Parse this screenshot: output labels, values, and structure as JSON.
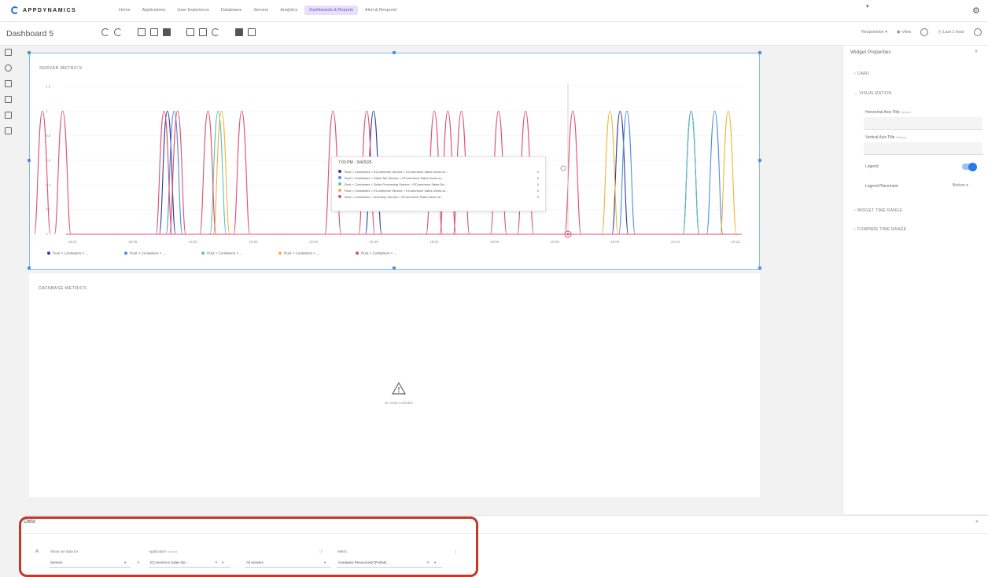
{
  "app": {
    "brand": "APPDYNAMICS"
  },
  "nav": {
    "tabs": [
      "Home",
      "Applications",
      "User Experience",
      "Databases",
      "Servers",
      "Analytics",
      "Dashboards & Reports",
      "Alert & Respond"
    ],
    "active_index": 6
  },
  "toolbar": {
    "dashboard_title": "Dashboard 5",
    "responsive_label": "Responsive",
    "view_label": "View",
    "time_range_label": "Last 1 hour"
  },
  "widgets": {
    "server_metrics": {
      "title": "SERVER METRICS",
      "y_ticks": [
        "1.2",
        "1",
        "0.8",
        "0.6",
        "0.4",
        "0.2",
        "0"
      ],
      "x_ticks": [
        "18:20",
        "18:25",
        "18:30",
        "18:35",
        "18:40",
        "18:45",
        "18:50",
        "18:55",
        "19:00",
        "19:05",
        "19:10",
        "19:15"
      ],
      "legend": [
        {
          "label": "Root > Containers > ...",
          "color": "#2c3e9c"
        },
        {
          "label": "Root > Containers > ...",
          "color": "#4a90e2"
        },
        {
          "label": "Root > Containers > ...",
          "color": "#5ec0c0"
        },
        {
          "label": "Root > Containers > ...",
          "color": "#f0b43c"
        },
        {
          "label": "Root > Containers > ...",
          "color": "#e05070"
        }
      ],
      "tooltip": {
        "time": "7:03 PM · 3/4/2025",
        "rows": [
          {
            "label": "Root > Containers > ECommerce Service > ECommerce Sales Demo ar...",
            "value": "0",
            "color": "#2c3e9c"
          },
          {
            "label": "Root > Containers > Sales Tax Service > ECommerce Sales Demo ar...",
            "value": "0",
            "color": "#4a90e2"
          },
          {
            "label": "Root > Containers > Order Processing Service > ECommerce Sales De...",
            "value": "0",
            "color": "#5ec0c0"
          },
          {
            "label": "Root > Containers > ECommerce Service > ECommerce Sales Demo ar...",
            "value": "0",
            "color": "#f0b43c"
          },
          {
            "label": "Root > Containers > Inventory Service > ECommerce Sales Demo ar...",
            "value": "0",
            "color": "#e05070"
          }
        ]
      }
    },
    "database_metrics": {
      "title": "DATABASE METRICS",
      "no_data": "No Data Available"
    }
  },
  "widget_properties": {
    "title": "Widget Properties",
    "sections": {
      "card": "CARD",
      "visualization": "VISUALIZATION",
      "widget_time_range": "WIDGET TIME RANGE",
      "compare_time_range": "COMPARE TIME RANGE"
    },
    "horizontal_axis_title": "Horizontal Axis Title",
    "vertical_axis_title": "Vertical Axis Title",
    "optional": "Optional",
    "legend_label": "Legend",
    "legend_enabled": true,
    "legend_placement_label": "Legend Placement",
    "legend_placement_value": "Bottom"
  },
  "data_panel": {
    "title": "Data",
    "show_data_as_label": "Show me data for",
    "show_data_as_value": "Servers",
    "application_label": "Application",
    "application_optional": "Optional",
    "application_value": "ECommerce Sales De...",
    "servers_value": "All Servers",
    "metric_label": "Metric",
    "metric_value": "Hardware Resources|CPU|%B..."
  },
  "chart_data": {
    "type": "line",
    "title": "SERVER METRICS",
    "ylim": [
      0,
      1.2
    ],
    "y_ticks": [
      0,
      0.2,
      0.4,
      0.6,
      0.8,
      1,
      1.2
    ],
    "x_ticks": [
      "18:20",
      "18:25",
      "18:30",
      "18:35",
      "18:40",
      "18:45",
      "18:50",
      "18:55",
      "19:00",
      "19:05",
      "19:10",
      "19:15"
    ],
    "legend_position": "bottom",
    "series": [
      {
        "name": "Root > Containers > ...",
        "color": "#2c3e9c",
        "pulses": [
          18.35,
          18.655,
          19.02,
          19.125
        ]
      },
      {
        "name": "Root > Containers > ...",
        "color": "#4a90e2",
        "pulses": [
          18.36,
          19.03,
          19.16
        ]
      },
      {
        "name": "Root > Containers > ...",
        "color": "#5ec0c0",
        "pulses": [
          18.425,
          19.125
        ]
      },
      {
        "name": "Root > Containers > ...",
        "color": "#f0b43c",
        "pulses": [
          18.43,
          19.005,
          19.18
        ]
      },
      {
        "name": "Root > Containers > ...",
        "color": "#e05070",
        "pulses": [
          18.165,
          18.195,
          18.345,
          18.365,
          18.41,
          18.46,
          18.595,
          18.645,
          18.745,
          18.765,
          18.785,
          18.84,
          18.88,
          18.95
        ]
      }
    ],
    "hover_time": "19:03"
  }
}
